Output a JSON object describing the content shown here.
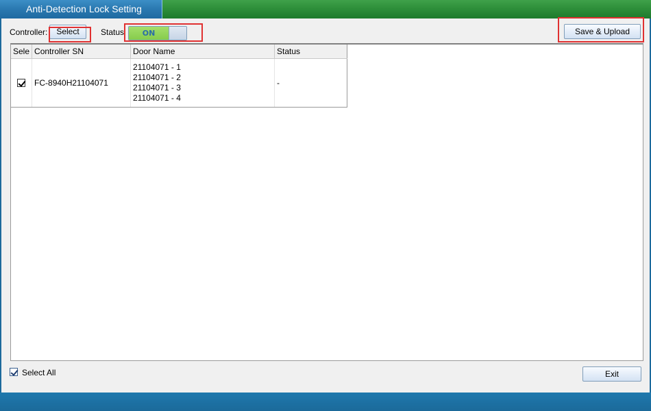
{
  "window": {
    "title": "Anti-Detection Lock Setting"
  },
  "toolbar": {
    "controller_label": "Controller:",
    "select_button": "Select",
    "status_label": "Status",
    "status_toggle_text": "ON",
    "status_toggle_on": true,
    "save_upload_button": "Save & Upload"
  },
  "table": {
    "columns": [
      "Sele",
      "Controller SN",
      "Door Name",
      "Status"
    ],
    "rows": [
      {
        "selected": true,
        "controller_sn": "FC-8940H21104071",
        "door_names": [
          "21104071 - 1",
          "21104071 - 2",
          "21104071 - 3",
          "21104071 - 4"
        ],
        "status": "-"
      }
    ]
  },
  "footer": {
    "select_all_label": "Select All",
    "select_all_checked": true,
    "exit_button": "Exit"
  },
  "colors": {
    "header_green": "#2e8f3a",
    "title_tab_blue": "#2a78b0",
    "frame_blue": "#1d6a9c",
    "toggle_on_green": "#86cc4c",
    "highlight_red": "#e03030"
  }
}
